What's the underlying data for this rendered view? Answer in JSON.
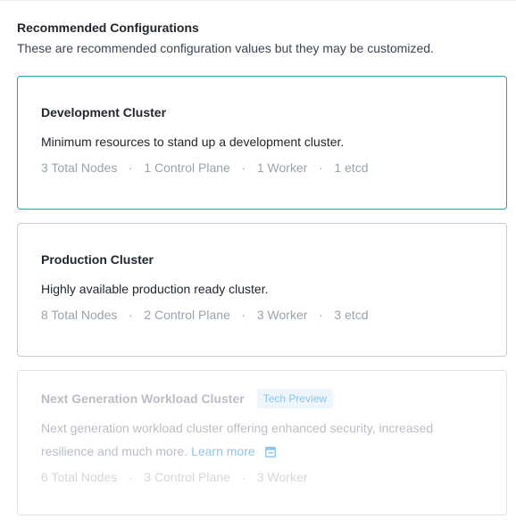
{
  "header": {
    "title": "Recommended Configurations",
    "subtitle": "These are recommended configuration values but they may be customized."
  },
  "cards": [
    {
      "title": "Development Cluster",
      "description": "Minimum resources to stand up a development cluster.",
      "stats": [
        "3 Total Nodes",
        "1 Control Plane",
        "1 Worker",
        "1 etcd"
      ],
      "selected": true,
      "disabled": false
    },
    {
      "title": "Production Cluster",
      "description": "Highly available production ready cluster.",
      "stats": [
        "8 Total Nodes",
        "2 Control Plane",
        "3 Worker",
        "3 etcd"
      ],
      "selected": false,
      "disabled": false
    },
    {
      "title": "Next Generation Workload Cluster",
      "badge": "Tech Preview",
      "description_line1": "Next generation workload cluster offering enhanced security, increased",
      "description_line2": "resilience and much more.",
      "learn_more": "Learn more",
      "stats": [
        "6 Total Nodes",
        "3 Control Plane",
        "3 Worker"
      ],
      "selected": false,
      "disabled": true
    }
  ],
  "separator": "·",
  "icons": {
    "external_link": "external-link-icon"
  },
  "colors": {
    "selected_border": "#1ea7b8",
    "link": "#8cc7ee",
    "badge_bg": "#eef6fc"
  }
}
